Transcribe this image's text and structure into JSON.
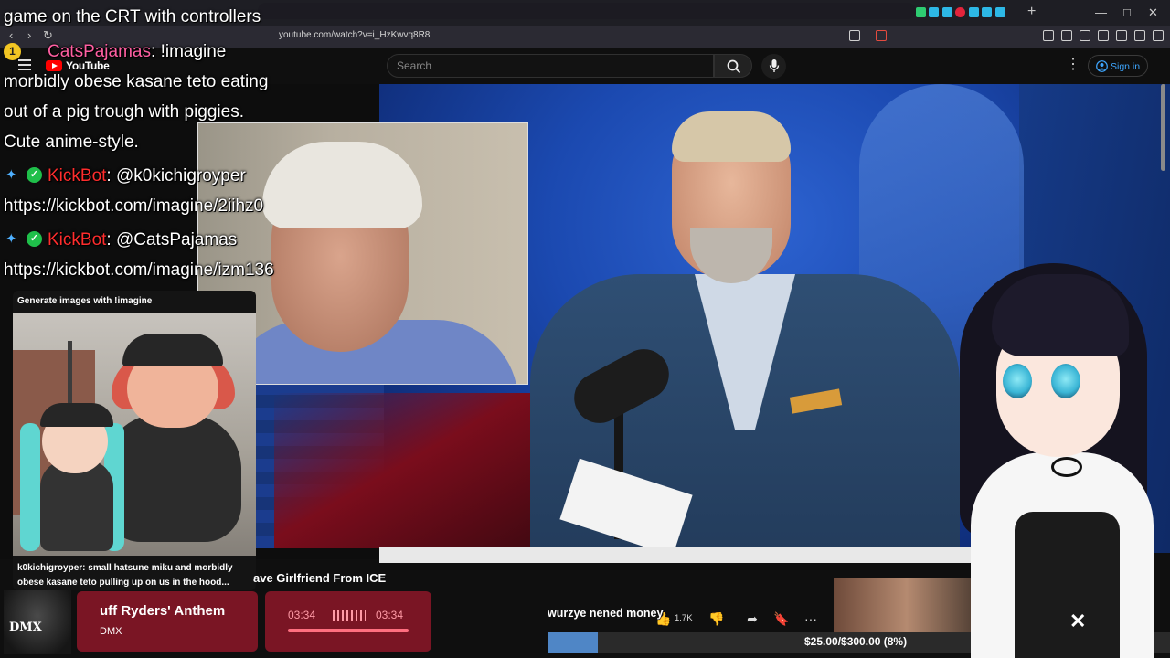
{
  "browser": {
    "url": "youtube.com/watch?v=i_HzKwvq8R8",
    "new_tab": "+",
    "minimize": "—",
    "maximize": "□",
    "close": "✕",
    "colors": {
      "tabstrip": "#1e1e24",
      "toolbar": "#2b2a33"
    }
  },
  "youtube": {
    "logo_text": "YouTube",
    "search_placeholder": "Search",
    "sign_in": "Sign in",
    "kebab": "⋮",
    "accent": "#3ea6ff"
  },
  "stream": {
    "top_caption": "game on the CRT with controllers",
    "chat": [
      {
        "user": "CatsPajamas",
        "sep": ": ",
        "text": "!imagine",
        "badge": "1"
      },
      {
        "text": "morbidly obese kasane teto eating"
      },
      {
        "text": "out of a pig trough with piggies."
      },
      {
        "text": "Cute anime-style."
      },
      {
        "user": "KickBot",
        "sep": ": ",
        "text": "@k0kichigroyper"
      },
      {
        "text": "https://kickbot.com/imagine/2iihz0"
      },
      {
        "user": "KickBot",
        "sep": ": ",
        "text": "@CatsPajamas"
      },
      {
        "text": "https://kickbot.com/imagine/izm136"
      }
    ],
    "generate_title": "Generate images with !imagine",
    "generate_caption": "k0kichigroyper: small hatsune miku and morbidly obese kasane teto pulling up on us in the hood...",
    "close_x": "✕"
  },
  "video": {
    "title": "ave Girlfriend From ICE",
    "comment_text": "wurzye nened money",
    "likes": "1.7K",
    "more": "···"
  },
  "music": {
    "art_text": "DMX",
    "title": "uff Ryders' Anthem",
    "artist": "DMX",
    "current_time": "03:34",
    "total_time": "03:34"
  },
  "goal": {
    "text": "$25.00/$300.00 (8%)",
    "fraction": 0.08,
    "color": "#4f86c6"
  }
}
